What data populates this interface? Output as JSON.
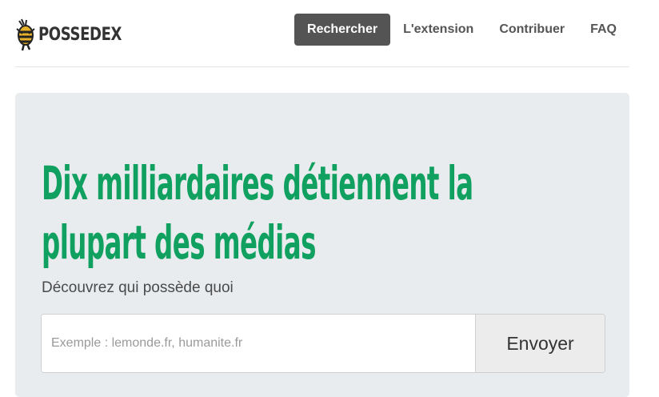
{
  "brand": {
    "name": "POSSEDEX",
    "logo_icon": "bee-logo-icon"
  },
  "nav": {
    "items": [
      {
        "label": "Rechercher",
        "active": true
      },
      {
        "label": "L'extension",
        "active": false
      },
      {
        "label": "Contribuer",
        "active": false
      },
      {
        "label": "FAQ",
        "active": false
      }
    ]
  },
  "hero": {
    "headline_line1": "Dix milliardaires détiennent la",
    "headline_line2": "plupart des médias",
    "subtitle": "Découvrez qui possède quoi"
  },
  "search": {
    "placeholder": "Exemple : lemonde.fr, humanite.fr",
    "value": "",
    "submit_label": "Envoyer"
  },
  "colors": {
    "accent": "#10a060",
    "nav_active_bg": "#545454",
    "hero_bg": "#e9ecef"
  }
}
